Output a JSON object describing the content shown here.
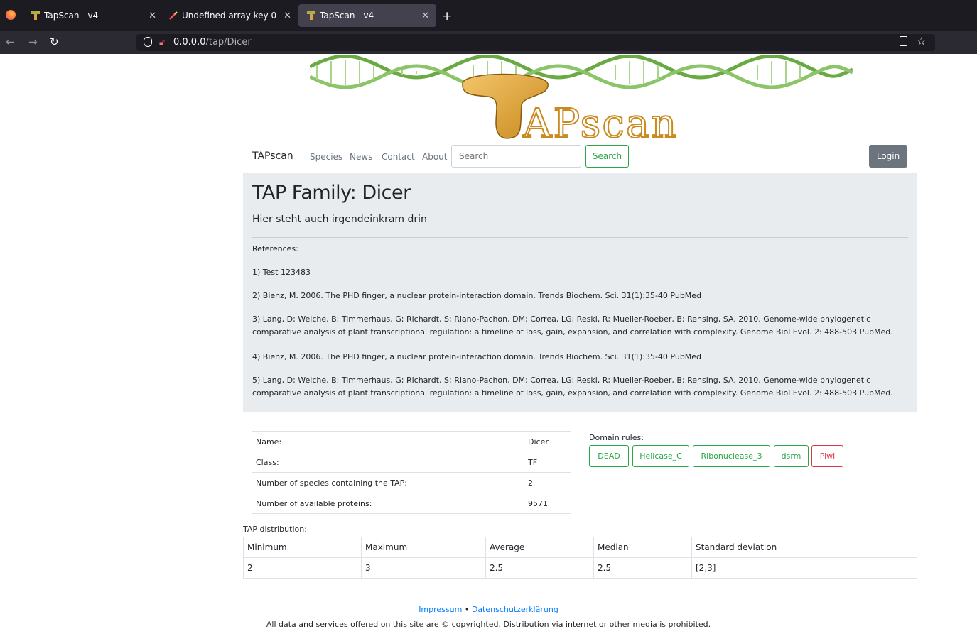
{
  "browser": {
    "tabs": [
      {
        "label": "TapScan - v4",
        "active": false
      },
      {
        "label": "Undefined array key 0",
        "active": false
      },
      {
        "label": "TapScan - v4",
        "active": true
      }
    ],
    "new_tab": "+",
    "url_host": "0.0.0.0",
    "url_path": "/tap/Dicer"
  },
  "nav": {
    "brand": "TAPscan",
    "links": [
      "Species",
      "News",
      "Contact",
      "About"
    ],
    "search_placeholder": "Search",
    "search_button": "Search",
    "login_button": "Login"
  },
  "logo": {
    "text": "APscan",
    "letter": "T"
  },
  "jumbo": {
    "title": "TAP Family: Dicer",
    "lead": "Hier steht auch irgendeinkram drin",
    "references_label": "References:",
    "references": [
      "1) Test 123483",
      "2) Bienz, M. 2006. The PHD finger, a nuclear protein-interaction domain. Trends Biochem. Sci. 31(1):35-40 PubMed",
      "3) Lang, D; Weiche, B; Timmerhaus, G; Richardt, S; Riano-Pachon, DM; Correa, LG; Reski, R; Mueller-Roeber, B; Rensing, SA. 2010. Genome-wide phylogenetic comparative analysis of plant transcriptional regulation: a timeline of loss, gain, expansion, and correlation with complexity. Genome Biol Evol. 2: 488-503 PubMed.",
      "4) Bienz, M. 2006. The PHD finger, a nuclear protein-interaction domain. Trends Biochem. Sci. 31(1):35-40 PubMed",
      "5) Lang, D; Weiche, B; Timmerhaus, G; Richardt, S; Riano-Pachon, DM; Correa, LG; Reski, R; Mueller-Roeber, B; Rensing, SA. 2010. Genome-wide phylogenetic comparative analysis of plant transcriptional regulation: a timeline of loss, gain, expansion, and correlation with complexity. Genome Biol Evol. 2: 488-503 PubMed."
    ]
  },
  "info": {
    "rows": [
      {
        "label": "Name:",
        "value": "Dicer"
      },
      {
        "label": "Class:",
        "value": "TF"
      },
      {
        "label": "Number of species containing the TAP:",
        "value": "2"
      },
      {
        "label": "Number of available proteins:",
        "value": "9571"
      }
    ]
  },
  "domains": {
    "label": "Domain rules:",
    "items": [
      {
        "name": "DEAD",
        "color": "#28a745"
      },
      {
        "name": "Helicase_C",
        "color": "#28a745"
      },
      {
        "name": "Ribonuclease_3",
        "color": "#28a745"
      },
      {
        "name": "dsrm",
        "color": "#28a745"
      },
      {
        "name": "Piwi",
        "color": "#dc3545"
      }
    ]
  },
  "distribution": {
    "label": "TAP distribution:",
    "headers": [
      "Minimum",
      "Maximum",
      "Average",
      "Median",
      "Standard deviation"
    ],
    "values": [
      "2",
      "3",
      "2.5",
      "2.5",
      "[2,3]"
    ]
  },
  "footer": {
    "impressum": "Impressum",
    "separator": "•",
    "privacy": "Datenschutzerklärung",
    "copyright": "All data and services offered on this site are © copyrighted. Distribution via internet or other media is prohibited."
  }
}
